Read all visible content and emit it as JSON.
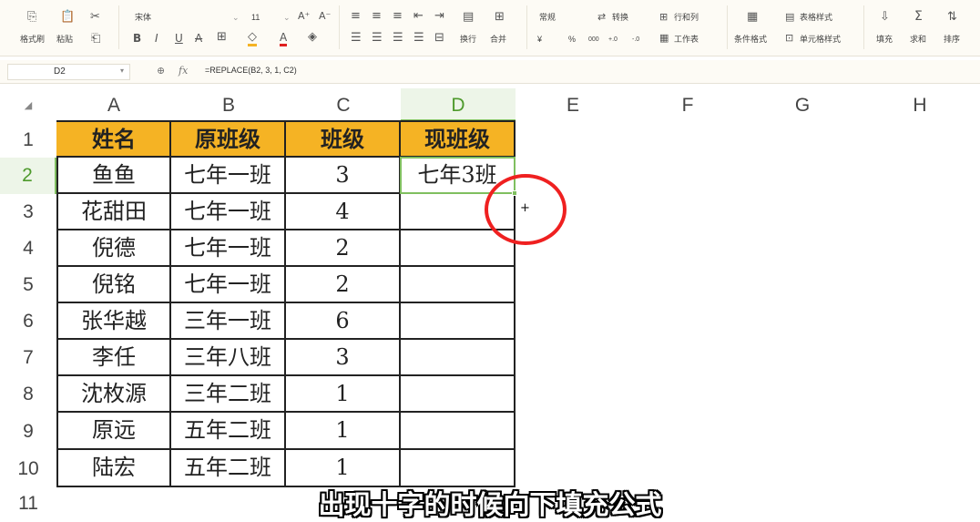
{
  "ribbon": {
    "format_painter": "格式刷",
    "paste": "粘贴",
    "font_name": "宋体",
    "font_size": "11",
    "font_color": "#e02020",
    "fill_color": "#f5b324",
    "number_format": "常规",
    "convert": "转换",
    "row_col": "行和列",
    "wrap": "换行",
    "merge": "合并",
    "worksheet": "工作表",
    "cond_format": "条件格式",
    "table_style": "表格样式",
    "cell_style": "单元格样式",
    "fill": "填充",
    "sum": "求和",
    "sort": "排序",
    "currency_icon": "¥",
    "percent_icon": "%",
    "thousands_icon": "000",
    "dec_inc_icon": "+.0",
    "dec_dec_icon": "-.0"
  },
  "formula_bar": {
    "cell_ref": "D2",
    "fx_label": "fx",
    "formula": "=REPLACE(B2, 3, 1, C2)"
  },
  "sheet": {
    "corner": "◢",
    "columns": [
      "A",
      "B",
      "C",
      "D",
      "E",
      "F",
      "G",
      "H"
    ],
    "rows": [
      "1",
      "2",
      "3",
      "4",
      "5",
      "6",
      "7",
      "8",
      "9",
      "10",
      "11"
    ],
    "header": [
      "姓名",
      "原班级",
      "班级",
      "现班级"
    ],
    "data": [
      [
        "鱼鱼",
        "七年一班",
        "3",
        "七年3班"
      ],
      [
        "花甜田",
        "七年一班",
        "4",
        ""
      ],
      [
        "倪德",
        "七年一班",
        "2",
        ""
      ],
      [
        "倪铭",
        "七年一班",
        "2",
        ""
      ],
      [
        "张华越",
        "三年一班",
        "6",
        ""
      ],
      [
        "李任",
        "三年八班",
        "3",
        ""
      ],
      [
        "沈枚源",
        "三年二班",
        "1",
        ""
      ],
      [
        "原远",
        "五年二班",
        "1",
        ""
      ],
      [
        "陆宏",
        "五年二班",
        "1",
        ""
      ]
    ],
    "active_cell": "D2",
    "selection_color": "#7fbf5f",
    "header_fill": "#f5b324"
  },
  "overlay": {
    "cursor": "+",
    "circle_color": "#ef2020",
    "caption": "出现十字的时候向下填充公式"
  }
}
